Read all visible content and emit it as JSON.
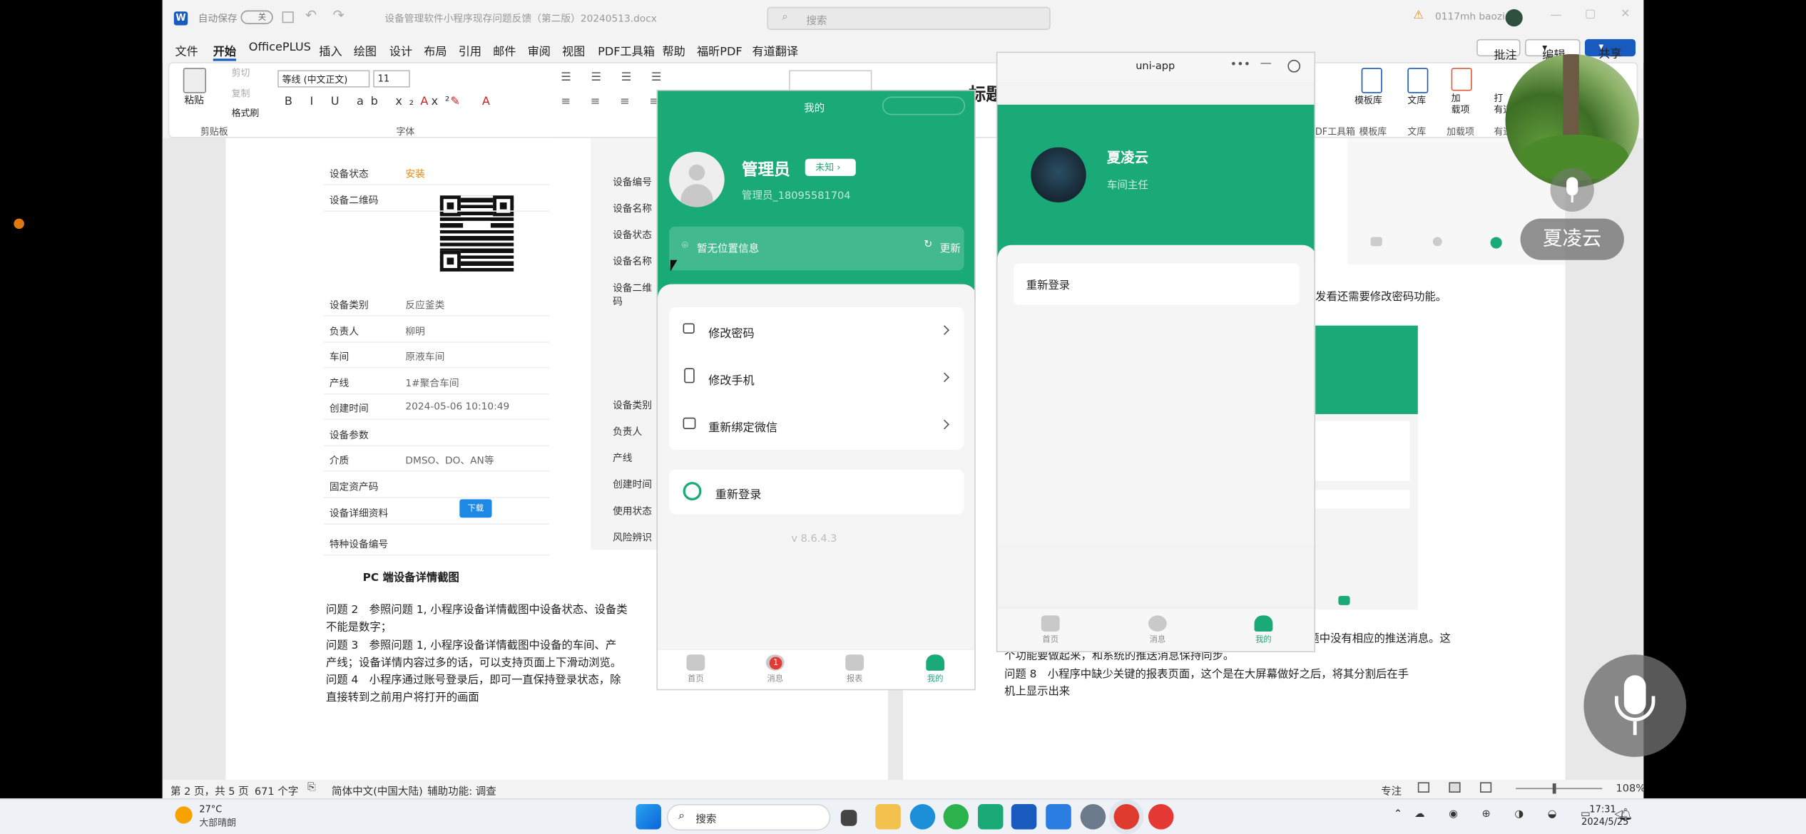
{
  "word": {
    "autosave": "自动保存",
    "autosave_state": "关",
    "doc_title": "设备管理软件小程序现存问题反馈（第二版）20240513.docx",
    "search_placeholder": "搜索",
    "user": "0117mh baozi",
    "menu": [
      "文件",
      "开始",
      "OfficePLUS",
      "插入",
      "绘图",
      "设计",
      "布局",
      "引用",
      "邮件",
      "审阅",
      "视图",
      "PDF工具箱",
      "福昕PDF",
      "帮助",
      "有道翻译"
    ],
    "actions": {
      "comment": "批注",
      "edit": "编辑",
      "share": "共享"
    },
    "ribbon": {
      "paste": "粘贴",
      "cut": "剪切",
      "copy": "复制",
      "format_painter": "格式刷",
      "clipboard": "剪贴板",
      "font_name": "等线 (中文正文)",
      "font_size": "11",
      "font_group": "字体",
      "title_style": "标题",
      "right_groups": [
        "模板库",
        "文库",
        "加载项",
        "有道"
      ],
      "right_labels": [
        "模板库",
        "文库",
        "加\n载项",
        "打\n有道"
      ],
      "tools": "PDF工具箱"
    },
    "left_table": [
      {
        "label": "设备状态",
        "value": "安装",
        "color": "#e08a1a"
      },
      {
        "label": "设备二维码",
        "value": ""
      },
      {
        "label": "设备类别",
        "value": "反应釜类"
      },
      {
        "label": "负责人",
        "value": "柳明"
      },
      {
        "label": "车间",
        "value": "原液车间"
      },
      {
        "label": "产线",
        "value": "1#聚合车间"
      },
      {
        "label": "创建时间",
        "value": "2024-05-06 10:10:49"
      },
      {
        "label": "设备参数",
        "value": ""
      },
      {
        "label": "介质",
        "value": "DMSO、DO、AN等"
      },
      {
        "label": "固定资产码",
        "value": ""
      },
      {
        "label": "设备详细资料",
        "value": ""
      },
      {
        "label": "特种设备编号",
        "value": ""
      }
    ],
    "download_btn": "下载",
    "mid_labels": [
      "设备编号",
      "设备名称",
      "设备状态",
      "设备名称",
      "设备二维码",
      "设备类别",
      "负责人",
      "产线",
      "创建时间",
      "使用状态",
      "风险辨识"
    ],
    "caption": "PC 端设备详情截图",
    "paragraphs": [
      "问题 2　参照问题 1, 小程序设备详情截图中设备状态、设备类",
      "不能是数字；",
      "问题 3　参照问题 1, 小程序设备详情截图中设备的车间、产",
      "产线；设备详情内容过多的话，可以支持页面上下滑动浏览。",
      "问题 4　小程序通过账号登录后，即可一直保持登录状态，除",
      "直接转到之前用户将打开的画面"
    ],
    "right_text_1": "发看还需要修改密码功能。",
    "right_paragraphs": [
      "题中没有相应的推送消息。这",
      "个功能要做起来，和系统的推送消息保持同步。",
      "问题 8　小程序中缺少关键的报表页面，这个是在大屏幕做好之后，将其分割后在手",
      "机上显示出来"
    ],
    "status": {
      "page": "第 2 页，共 5 页",
      "words": "671 个字",
      "lang": "简体中文(中国大陆)",
      "access": "辅助功能: 调查",
      "focus": "专注",
      "zoom": "108%"
    }
  },
  "phone_left": {
    "title": "我的",
    "name": "管理员",
    "badge": "未知",
    "account": "管理员_18095581704",
    "location": "暂无位置信息",
    "refresh": "更新",
    "menu": [
      "修改密码",
      "修改手机",
      "重新绑定微信"
    ],
    "logout": "重新登录",
    "version": "v 8.6.4.3",
    "tabs": [
      "首页",
      "消息",
      "报表",
      "我的"
    ],
    "msg_count": "1"
  },
  "phone_right": {
    "window_title": "uni-app",
    "name": "夏凌云",
    "role": "车间主任",
    "logout": "重新登录",
    "tabs": [
      "首页",
      "消息",
      "我的"
    ]
  },
  "video": {
    "speaker": "夏凌云"
  },
  "taskbar": {
    "weather_temp": "27°C",
    "weather_desc": "大部晴朗",
    "search": "搜索",
    "time": "17:31",
    "date": "2024/5/25"
  },
  "colors": {
    "green": "#1aaa77",
    "word_blue": "#185abd",
    "bg": "#f3f3f3"
  }
}
